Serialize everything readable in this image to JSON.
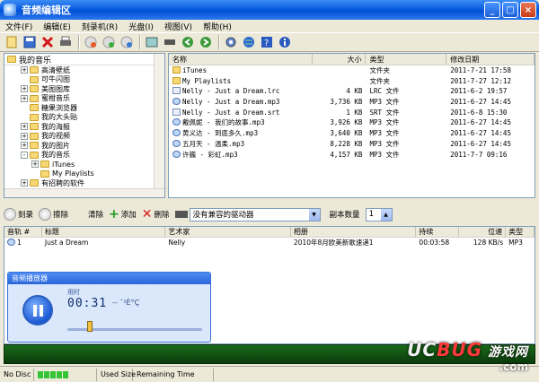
{
  "window": {
    "title": "音频编辑区",
    "minimize": "_",
    "maximize": "□",
    "close": "×"
  },
  "menu": [
    {
      "label": "文件(F)"
    },
    {
      "label": "编辑(E)"
    },
    {
      "label": "刻录机(R)"
    },
    {
      "label": "光盘(I)"
    },
    {
      "label": "视图(V)"
    },
    {
      "label": "帮助(H)"
    }
  ],
  "toolbar": {
    "icons": [
      "new-icon",
      "save-icon",
      "delete-icon",
      "print-icon",
      "burn-icon",
      "disc-icon",
      "copy-icon",
      "info-icon",
      "drive-icon",
      "back-icon",
      "forward-icon",
      "settings-icon",
      "globe-icon",
      "help-icon",
      "about-icon"
    ]
  },
  "tree": {
    "root": "我的音乐",
    "items": [
      {
        "label": "高清壁纸",
        "expander": "+"
      },
      {
        "label": "可牛闪图",
        "expander": ""
      },
      {
        "label": "美图图库",
        "expander": "+"
      },
      {
        "label": "蜜柑音乐",
        "expander": "+"
      },
      {
        "label": "糖果浏览器",
        "expander": ""
      },
      {
        "label": "我的大头贴",
        "expander": ""
      },
      {
        "label": "我的海报",
        "expander": "+"
      },
      {
        "label": "我的视频",
        "expander": "+"
      },
      {
        "label": "我的图片",
        "expander": "+"
      },
      {
        "label": "我的音乐",
        "expander": "-"
      },
      {
        "label": "iTunes",
        "expander": "+",
        "indent": 2
      },
      {
        "label": "My Playlists",
        "expander": "",
        "indent": 2
      },
      {
        "label": "有招聘的软件",
        "expander": "+"
      }
    ]
  },
  "filelist": {
    "headers": {
      "name": "名称",
      "size": "大小",
      "type": "类型",
      "date": "修改日期"
    },
    "rows": [
      {
        "name": "iTunes",
        "size": "",
        "type": "文件夹",
        "date": "2011-7-21 17:58",
        "icon": "folder"
      },
      {
        "name": "My Playlists",
        "size": "",
        "type": "文件夹",
        "date": "2011-7-27 12:12",
        "icon": "folder"
      },
      {
        "name": "Nelly - Just a Dream.lrc",
        "size": "4 KB",
        "type": "LRC 文件",
        "date": "2011-6-2 19:57",
        "icon": "file"
      },
      {
        "name": "Nelly - Just a Dream.mp3",
        "size": "3,736 KB",
        "type": "MP3 文件",
        "date": "2011-6-27 14:45",
        "icon": "music"
      },
      {
        "name": "Nelly - Just a Dream.srt",
        "size": "1 KB",
        "type": "SRT 文件",
        "date": "2011-6-8 15:30",
        "icon": "file"
      },
      {
        "name": "戴佩妮 - 我们的故事.mp3",
        "size": "3,926 KB",
        "type": "MP3 文件",
        "date": "2011-6-27 14:45",
        "icon": "music"
      },
      {
        "name": "黄义达 - 到底多久.mp3",
        "size": "3,640 KB",
        "type": "MP3 文件",
        "date": "2011-6-27 14:45",
        "icon": "music"
      },
      {
        "name": "五月天 - 温柔.mp3",
        "size": "8,228 KB",
        "type": "MP3 文件",
        "date": "2011-6-27 14:45",
        "icon": "music"
      },
      {
        "name": "许巍 - 彩虹.mp3",
        "size": "4,157 KB",
        "type": "MP3 文件",
        "date": "2011-7-7 09:16",
        "icon": "music"
      }
    ]
  },
  "burnbar": {
    "burn": "刻录",
    "erase": "擦除",
    "clear": "清除",
    "add": "添加",
    "delete": "删除",
    "drive": "没有兼容的驱动器",
    "copies_label": "副本数量",
    "copies_value": "1"
  },
  "tracks": {
    "headers": {
      "no": "音轨 #",
      "title": "标题",
      "artist": "艺术家",
      "album": "相册",
      "duration": "持续",
      "bitrate": "位速",
      "format": "类型"
    },
    "rows": [
      {
        "no": "1",
        "title": "Just a Dream",
        "artist": "Nelly",
        "album": "2010年8月欧美新歌速递1",
        "duration": "00:03:58",
        "bitrate": "128 KB/s",
        "format": "MP3"
      }
    ]
  },
  "player": {
    "title": "音频播放器",
    "time_label": "用时",
    "time": "00:31",
    "info": "-- ˉ²È°Ç"
  },
  "logo": {
    "uc": "UC",
    "bug": "BUG",
    "cn": "游戏网",
    "domain": ".com"
  },
  "status": {
    "disc": "No Disc",
    "used": "Used Size",
    "remaining": "Remaining Time"
  }
}
